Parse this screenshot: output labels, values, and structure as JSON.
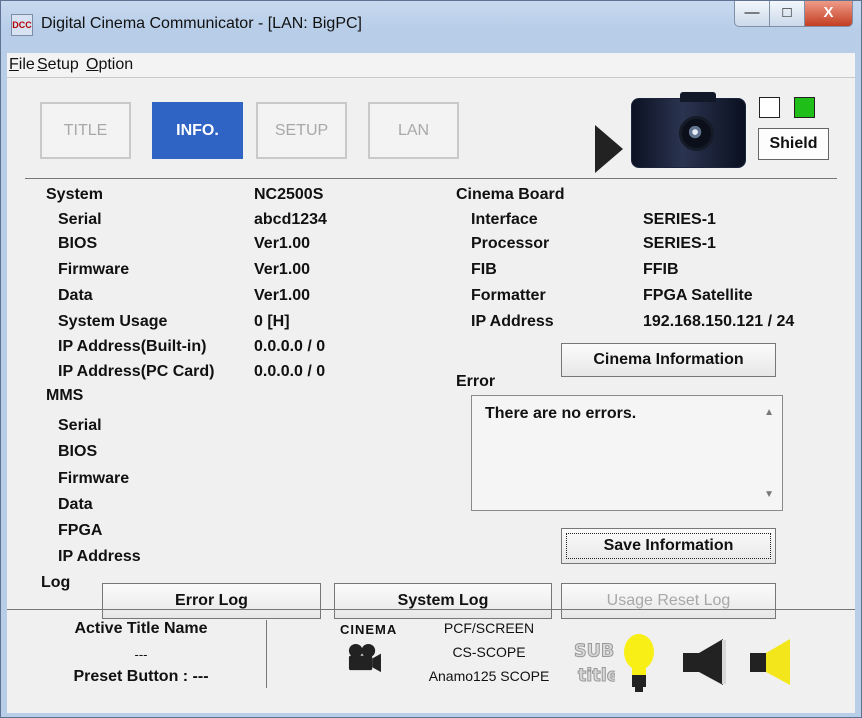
{
  "window": {
    "title": "Digital Cinema Communicator - [LAN: BigPC]",
    "app_icon_text": "DCC",
    "controls": {
      "minimize": "—",
      "maximize": "□",
      "close": "X"
    }
  },
  "menubar": {
    "items": [
      {
        "label": "File",
        "mnemonic": "F"
      },
      {
        "label": "Setup",
        "mnemonic": "S"
      },
      {
        "label": "Option",
        "mnemonic": "O"
      }
    ]
  },
  "toolbar": {
    "tabs": [
      {
        "label": "TITLE",
        "state": "inactive"
      },
      {
        "label": "INFO.",
        "state": "active"
      },
      {
        "label": "SETUP",
        "state": "inactive"
      },
      {
        "label": "LAN",
        "state": "inactive"
      }
    ],
    "shield_label": "Shield",
    "status_colors": {
      "empty": "#ffffff",
      "green": "#1fbe19"
    }
  },
  "system": {
    "title": "System",
    "model": "NC2500S",
    "rows": [
      {
        "label": "Serial",
        "value": "abcd1234"
      },
      {
        "label": "BIOS",
        "value": "Ver1.00"
      },
      {
        "label": "Firmware",
        "value": "Ver1.00"
      },
      {
        "label": "Data",
        "value": "Ver1.00"
      },
      {
        "label": "System Usage",
        "value": "0 [H]"
      },
      {
        "label": "IP Address(Built-in)",
        "value": "0.0.0.0 / 0"
      },
      {
        "label": "IP Address(PC Card)",
        "value": "0.0.0.0 / 0"
      }
    ]
  },
  "mms": {
    "title": "MMS",
    "rows": [
      {
        "label": "Serial"
      },
      {
        "label": "BIOS"
      },
      {
        "label": "Firmware"
      },
      {
        "label": "Data"
      },
      {
        "label": "FPGA"
      },
      {
        "label": "IP Address"
      }
    ]
  },
  "cinema_board": {
    "title": "Cinema Board",
    "rows": [
      {
        "label": "Interface",
        "value": "SERIES-1"
      },
      {
        "label": "Processor",
        "value": "SERIES-1"
      },
      {
        "label": "FIB",
        "value": "FFIB"
      },
      {
        "label": "Formatter",
        "value": "FPGA Satellite"
      },
      {
        "label": "IP Address",
        "value": "192.168.150.121 / 24"
      }
    ],
    "button_label": "Cinema Information"
  },
  "error": {
    "title": "Error",
    "text": "There are no errors.",
    "scroll_up": "▲",
    "scroll_down": "▼",
    "save_label": "Save Information"
  },
  "log": {
    "title": "Log",
    "buttons": [
      {
        "label": "Error Log",
        "enabled": true
      },
      {
        "label": "System Log",
        "enabled": true
      },
      {
        "label": "Usage Reset Log",
        "enabled": false
      }
    ]
  },
  "status": {
    "active_title_label": "Active Title Name",
    "active_title_value": "---",
    "preset_label": "Preset Button : ---",
    "cinema_word": "CINEMA",
    "format_lines": [
      "PCF/SCREEN",
      "CS-SCOPE",
      "Anamo125 SCOPE"
    ],
    "icons": [
      "cinema-camera-icon",
      "subtitle-icon",
      "light-bulb-icon",
      "speaker-mute-icon",
      "speaker-active-icon"
    ],
    "colors": {
      "bulb": "#f8ef16",
      "speaker_active": "#f3e71c"
    }
  }
}
